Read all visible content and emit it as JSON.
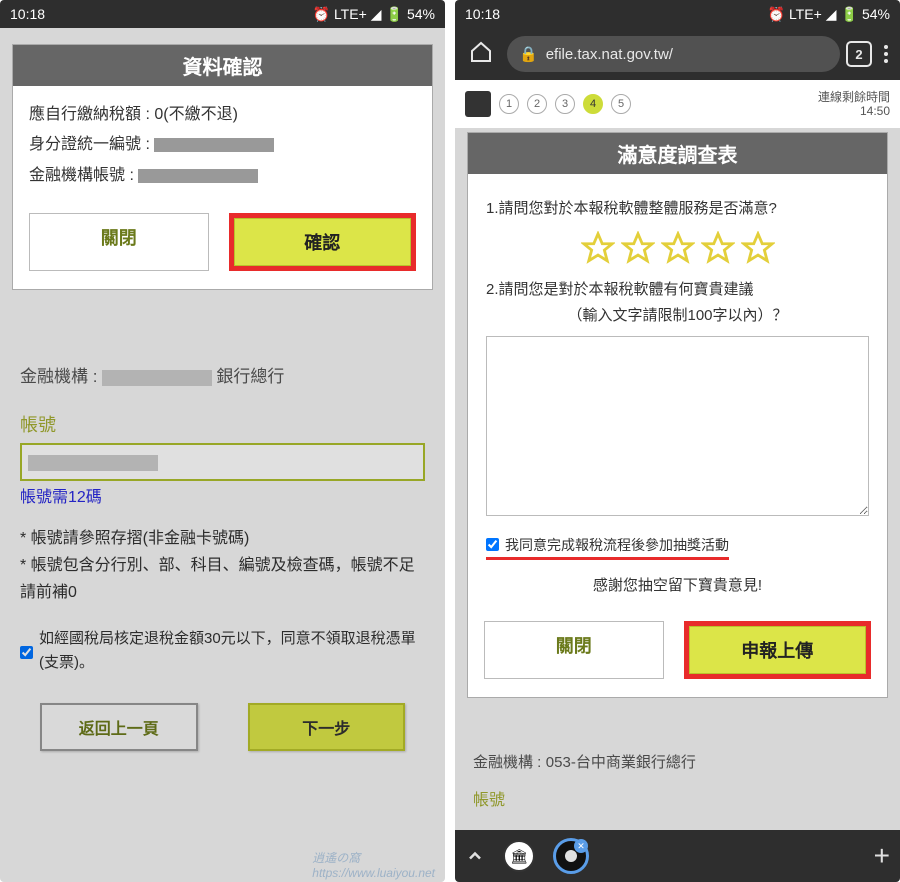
{
  "status": {
    "time": "10:18",
    "network": "LTE+",
    "battery": "54%"
  },
  "left": {
    "modal": {
      "title": "資料確認",
      "l1_label": "應自行繳納稅額 :",
      "l1_value": "0(不繳不退)",
      "l2_label": "身分證統一編號 :",
      "l3_label": "金融機構帳號 :",
      "close": "關閉",
      "confirm": "確認"
    },
    "bank_label": "金融機構 :",
    "bank_suffix": "銀行總行",
    "account_label": "帳號",
    "account_hint": "帳號需12碼",
    "note1": "* 帳號請參照存摺(非金融卡號碼)",
    "note2": "* 帳號包含分行別、部、科目、編號及檢查碼，帳號不足請前補0",
    "consent": "如經國稅局核定退稅金額30元以下，同意不領取退稅憑單(支票)。",
    "back": "返回上一頁",
    "next": "下一步"
  },
  "right": {
    "url": "efile.tax.nat.gov.tw/",
    "tabs": "2",
    "steps": {
      "s1": "1",
      "s2": "2",
      "s3": "3",
      "s4": "4",
      "s5": "5",
      "time_label": "連線剩餘時間",
      "time_value": "14:50"
    },
    "survey": {
      "title": "滿意度調查表",
      "q1": "1.請問您對於本報稅軟體整體服務是否滿意?",
      "q2a": "2.請問您是對於本報稅軟體有何寶貴建議",
      "q2b": "（輸入文字請限制100字以內）？",
      "agree": "我同意完成報稅流程後參加抽獎活動",
      "thanks": "感謝您抽空留下寶貴意見!",
      "close": "關閉",
      "submit": "申報上傳"
    },
    "bank_label": "金融機構 :",
    "bank_value": "053-台中商業銀行總行",
    "account_label": "帳號"
  }
}
